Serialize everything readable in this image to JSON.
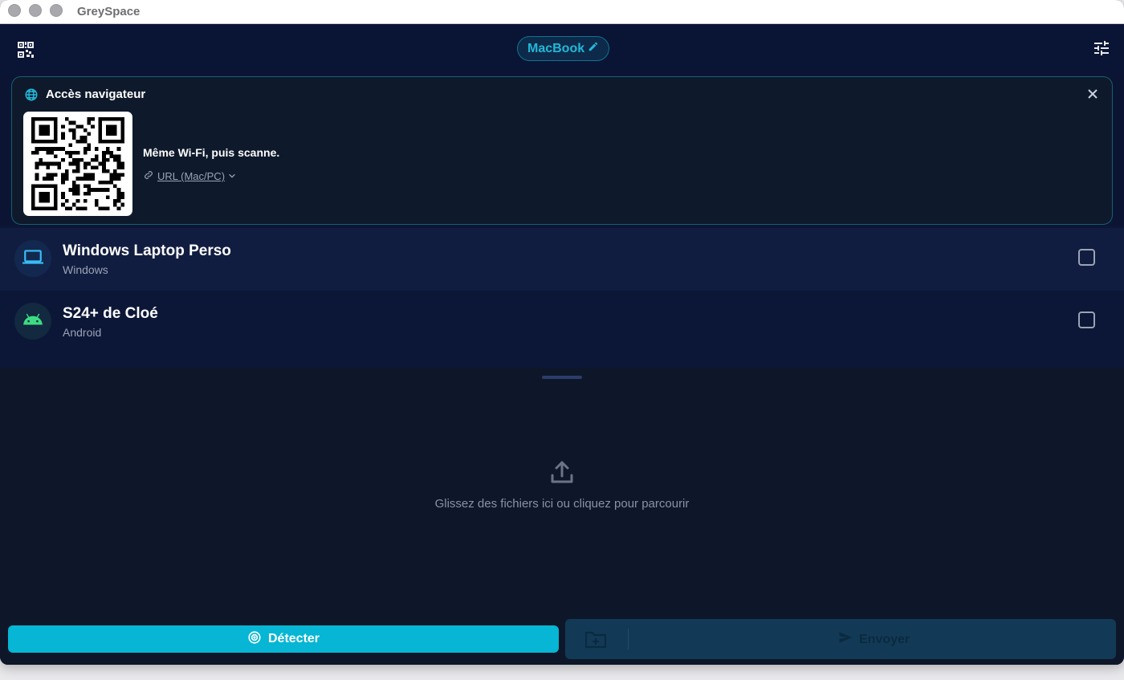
{
  "window": {
    "title": "GreySpace"
  },
  "header": {
    "device_name": "MacBook",
    "icons": [
      "qr-code-icon",
      "pencil-icon",
      "sliders-icon"
    ]
  },
  "access_card": {
    "title": "Accès navigateur",
    "instruction": "Même Wi-Fi, puis scanne.",
    "url_selector": "URL (Mac/PC)",
    "icons": [
      "globe-icon",
      "link-icon",
      "chevron-down-icon",
      "close-icon"
    ]
  },
  "devices": [
    {
      "name": "Windows Laptop Perso",
      "os": "Windows",
      "icon": "laptop-icon",
      "checked": false,
      "color": "#38bdf8"
    },
    {
      "name": "S24+ de Cloé",
      "os": "Android",
      "icon": "android-icon",
      "checked": false,
      "color": "#3ddc84"
    }
  ],
  "drop_zone": {
    "text": "Glissez des fichiers ici ou cliquez pour parcourir",
    "icon": "upload-icon"
  },
  "actions": {
    "detect_label": "Détecter",
    "send_label": "Envoyer",
    "icons": [
      "radar-icon",
      "folder-plus-icon",
      "send-icon"
    ]
  },
  "colors": {
    "accent": "#06b6d4",
    "background": "#0b1533",
    "surface": "#0e1729"
  }
}
